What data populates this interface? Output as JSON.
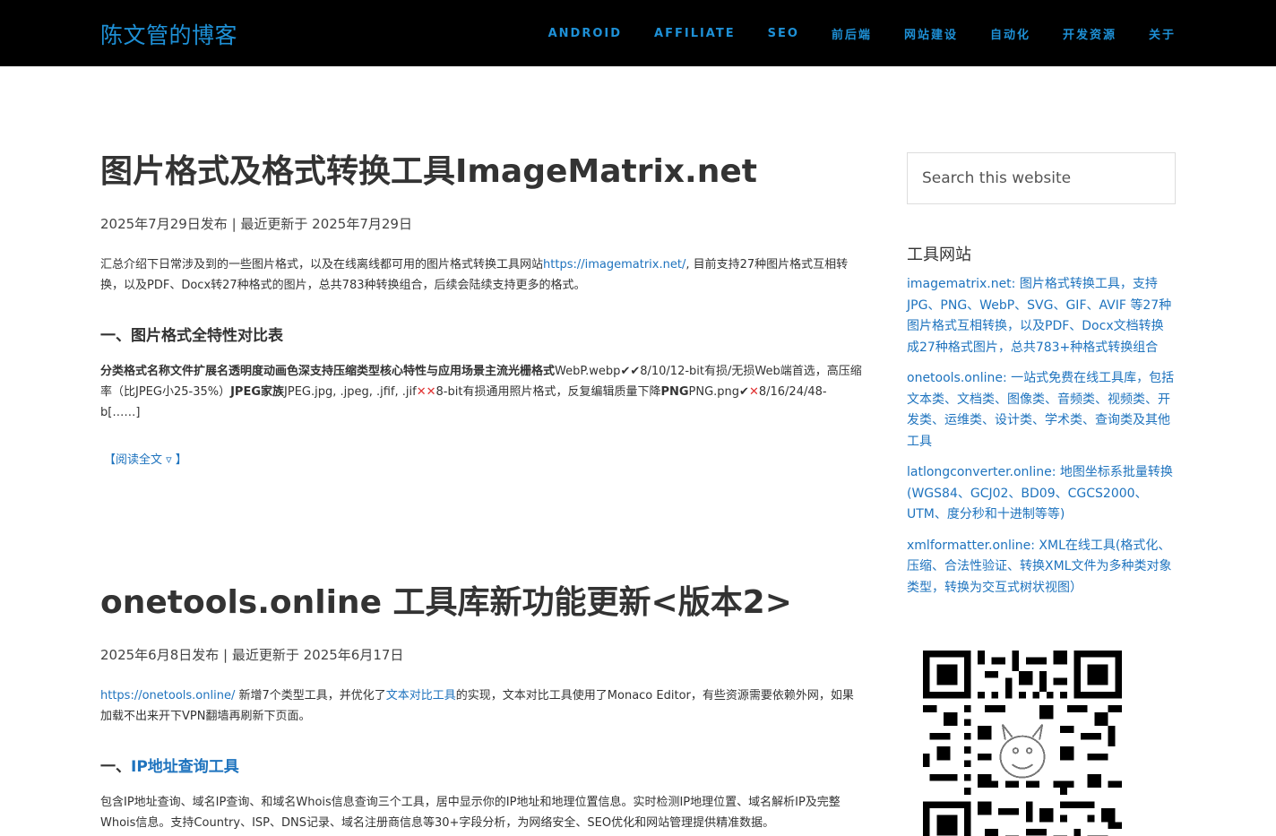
{
  "site": {
    "title": "陈文管的博客"
  },
  "nav": {
    "items": [
      {
        "label": "ANDROID"
      },
      {
        "label": "AFFILIATE"
      },
      {
        "label": "SEO"
      },
      {
        "label": "前后端"
      },
      {
        "label": "网站建设"
      },
      {
        "label": "自动化"
      },
      {
        "label": "开发资源"
      },
      {
        "label": "关于"
      }
    ]
  },
  "posts": [
    {
      "title": "图片格式及格式转换工具ImageMatrix.net",
      "meta": "2025年7月29日发布 | 最近更新于 2025年7月29日",
      "intro_a": "汇总介绍下日常涉及到的一些图片格式，以及在线离线都可用的图片格式转换工具网站",
      "intro_link": "https://imagematrix.net/",
      "intro_b": ", 目前支持27种图片格式互相转换，以及PDF、Docx转27种格式的图片，总共783种转换组合，后续会陆续支持更多的格式。",
      "section_heading": "一、图片格式全特性对比表",
      "excerpt_bold_1": "分类格式名称文件扩展名透明度动画色深支持压缩类型核心特性与应用场景主流光栅格式",
      "excerpt_1": "WebP.webp✔✔8/10/12-bit有损/无损Web端首选，高压缩率（比JPEG小25-35%）",
      "excerpt_bold_2": "JPEG家族",
      "excerpt_2a": "JPEG.jpg, .jpeg, .jfif, .jif",
      "excerpt_x1": "✕✕",
      "excerpt_2b": "8-bit有损通用照片格式，反复编辑质量下降",
      "excerpt_bold_3": "PNG",
      "excerpt_3a": "PNG.png✔",
      "excerpt_x2": "✕",
      "excerpt_3b": "8/16/24/48-b[……]",
      "read_more": "【阅读全文 ▿ 】"
    },
    {
      "title": "onetools.online 工具库新功能更新<版本2>",
      "meta": "2025年6月8日发布 | 最近更新于 2025年6月17日",
      "intro_link_1": "https://onetools.online/",
      "intro_a": " 新增7个类型工具，并优化了",
      "intro_link_2": "文本对比工具",
      "intro_b": "的实现，文本对比工具使用了Monaco Editor，有些资源需要依赖外网，如果加载不出来开下VPN翻墙再刷新下页面。",
      "section_prefix": "一、",
      "section_link": "IP地址查询工具",
      "body": "包含IP地址查询、域名IP查询、和域名Whois信息查询三个工具，居中显示你的IP地址和地理位置信息。实时检测IP地理位置、域名解析IP及完整Whois信息。支持Country、ISP、DNS记录、域名注册商信息等30+字段分析，为网络安全、SEO优化和网站管理提供精准数据。"
    }
  ],
  "sidebar": {
    "search_placeholder": "Search this website",
    "widget_title": "工具网站",
    "links": [
      {
        "text": "imagematrix.net: 图片格式转换工具，支持JPG、PNG、WebP、SVG、GIF、AVIF 等27种图片格式互相转换，以及PDF、Docx文档转换成27种格式图片，总共783+种格式转换组合"
      },
      {
        "text": "onetools.online: 一站式免费在线工具库，包括文本类、文档类、图像类、音频类、视频类、开发类、运维类、设计类、学术类、查询类及其他工具"
      },
      {
        "text": "latlongconverter.online: 地图坐标系批量转换(WGS84、GCJ02、BD09、CGCS2000、UTM、度分秒和十进制等等)"
      },
      {
        "text": "xmlformatter.online: XML在线工具(格式化、压缩、合法性验证、转换XML文件为多种类对象类型，转换为交互式树状视图）"
      }
    ]
  },
  "colors": {
    "header_bg": "#000000",
    "accent": "#1e90d6",
    "link": "#1e73be",
    "cross": "#e03131"
  }
}
